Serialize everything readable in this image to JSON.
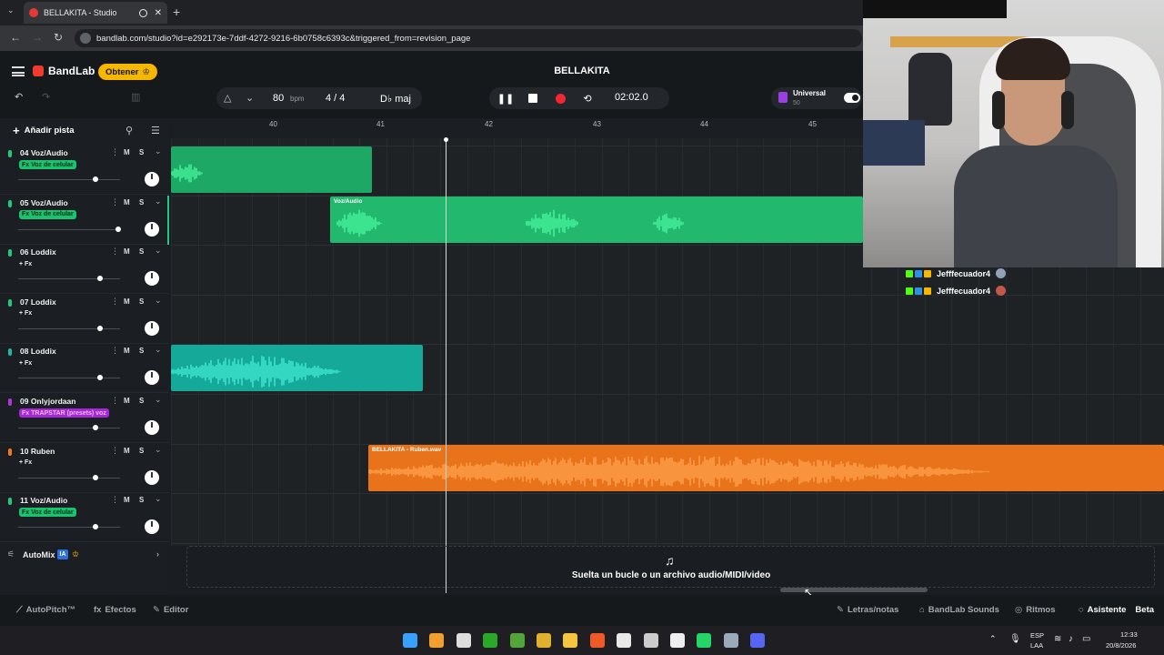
{
  "browser": {
    "tab_title": "BELLAKITA - Studio",
    "url": "bandlab.com/studio?id=e292173e-7ddf-4272-9216-6b0758c6393c&triggered_from=revision_page"
  },
  "header": {
    "brand": "BandLab",
    "get_button": "Obtener",
    "song_title": "BELLAKITA"
  },
  "toolbar": {
    "bpm_value": "80",
    "bpm_label": "bpm",
    "time_signature": "4 / 4",
    "key": "D♭ maj",
    "time": "02:02.0",
    "universal_label": "Universal",
    "universal_value": "50"
  },
  "track_panel": {
    "add_track": "Añadir pista",
    "mute_label": "M",
    "solo_label": "S"
  },
  "tracks": [
    {
      "name": "04 Voz/Audio",
      "fx": "Fx Voz de celular",
      "color": "#21c97a",
      "fx_style": "green",
      "volume": 0.76,
      "selected": false
    },
    {
      "name": "05 Voz/Audio",
      "fx": "Fx Voz de celular",
      "color": "#21c97a",
      "fx_style": "green",
      "volume": 0.98,
      "selected": true
    },
    {
      "name": "06 Loddix",
      "fx": "+ Fx",
      "color": "#21c97a",
      "fx_style": "plain",
      "volume": 0.8,
      "selected": false
    },
    {
      "name": "07 Loddix",
      "fx": "+ Fx",
      "color": "#21c97a",
      "fx_style": "plain",
      "volume": 0.8,
      "selected": false
    },
    {
      "name": "08 Loddix",
      "fx": "+ Fx",
      "color": "#1fb8a6",
      "fx_style": "plain",
      "volume": 0.8,
      "selected": false
    },
    {
      "name": "09 Onlyjordaan",
      "fx": "Fx TRAPSTAR (presets) voz",
      "color": "#b633e0",
      "fx_style": "purple",
      "volume": 0.76,
      "selected": false
    },
    {
      "name": "10 Ruben",
      "fx": "+ Fx",
      "color": "#f07a1f",
      "fx_style": "plain",
      "volume": 0.76,
      "selected": false
    },
    {
      "name": "11 Voz/Audio",
      "fx": "Fx Voz de celular",
      "color": "#21c97a",
      "fx_style": "green",
      "volume": 0.76,
      "selected": false
    }
  ],
  "automix": {
    "label": "AutoMix",
    "badge": "IA"
  },
  "ruler": [
    "40",
    "41",
    "42",
    "43",
    "44",
    "45"
  ],
  "clips": [
    {
      "track": 0,
      "name": "",
      "color": "#1ea865"
    },
    {
      "track": 1,
      "name": "Voz/Audio",
      "color": "#22b86e"
    },
    {
      "track": 4,
      "name": "",
      "color": "#15a99a"
    },
    {
      "track": 6,
      "name": "BELLAKITA - Ruben.wav",
      "color": "#e8731a"
    }
  ],
  "dropzone": {
    "text": "Suelta un bucle o un archivo audio/MIDI/video"
  },
  "bottom_bar": {
    "autopitch": "AutoPitch™",
    "effects": "Efectos",
    "editor": "Editor",
    "lyrics": "Letras/notas",
    "sounds": "BandLab Sounds",
    "rhythms": "Ritmos",
    "assistant": "Asistente",
    "assistant_badge": "Beta"
  },
  "taskbar": {
    "lang": "ESP",
    "lang_sub": "LAA",
    "clock": "12:33",
    "date": "20/8/2026"
  },
  "chat": [
    {
      "user": "Jefffecuador4"
    },
    {
      "user": "Jefffecuador4"
    }
  ]
}
